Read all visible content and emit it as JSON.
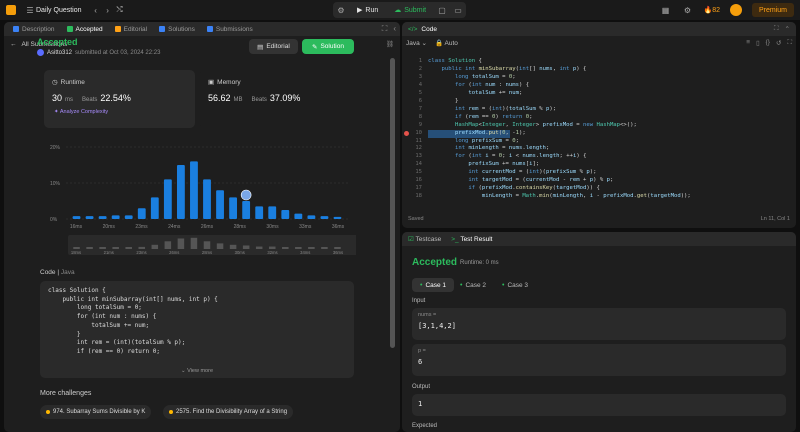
{
  "topbar": {
    "title": "Daily Question",
    "run_label": "Run",
    "submit_label": "Submit",
    "streak": "82",
    "premium_label": "Premium"
  },
  "left": {
    "tabs": [
      {
        "label": "Description",
        "color": "#3b82f6"
      },
      {
        "label": "Accepted",
        "color": "#2cbb5d"
      },
      {
        "label": "Editorial",
        "color": "#ffa116"
      },
      {
        "label": "Solutions",
        "color": "#3b82f6"
      },
      {
        "label": "Submissions",
        "color": "#3b82f6"
      }
    ],
    "all_submissions": "All Submissions",
    "status": "Accepted",
    "author": "Asitto312",
    "submitted_at": "submitted at Oct 03, 2024 22:23",
    "editorial_button": "Editorial",
    "solution_button": "Solution",
    "runtime": {
      "label": "Runtime",
      "value": "30",
      "unit": "ms",
      "beats_label": "Beats",
      "beats": "22.54%",
      "analyze": "Analyze Complexity"
    },
    "memory": {
      "label": "Memory",
      "value": "56.62",
      "unit": "MB",
      "beats_label": "Beats",
      "beats": "37.09%"
    },
    "code_header": "Code",
    "code_lang": "Java",
    "code_snippet": "class Solution {\n    public int minSubarray(int[] nums, int p) {\n        long totalSum = 0;\n        for (int num : nums) {\n            totalSum += num;\n        }\n        int rem = (int)(totalSum % p);\n        if (rem == 0) return 0;",
    "view_more": "View more",
    "more_challenges": "More challenges",
    "challenges": [
      "974. Subarray Sums Divisible by K",
      "2575. Find the Divisibility Array of a String"
    ]
  },
  "chart_data": {
    "type": "bar",
    "yticks": [
      "20%",
      "10%",
      "0%"
    ],
    "ylim": [
      0,
      20
    ],
    "categories": [
      "16ms",
      "",
      "20ms",
      "",
      "23ms",
      "",
      "",
      "24ms",
      "",
      "26ms",
      "",
      "28ms",
      "",
      "30ms",
      "",
      "33ms",
      "",
      "36ms",
      "",
      "",
      ""
    ],
    "values": [
      0.8,
      0.8,
      0.8,
      1,
      1,
      3,
      6,
      11,
      15,
      16,
      11,
      8,
      6,
      5,
      3.5,
      3.5,
      2.5,
      1.5,
      1,
      0.8,
      0.6
    ],
    "highlight_index": 13,
    "bar_color": "#1a7fe0",
    "xlabels": [
      "16ms",
      "20ms",
      "23ms",
      "24ms",
      "26ms",
      "28ms",
      "30ms",
      "33ms",
      "36ms"
    ],
    "mini_labels": [
      "18ms",
      "21ms",
      "23ms",
      "26ms",
      "28ms",
      "30ms",
      "32ms",
      "34ms",
      "36ms"
    ]
  },
  "editor": {
    "title": "Code",
    "language": "Java",
    "mode": "Auto",
    "saved": "Saved",
    "cursor": "Ln 11, Col 1"
  },
  "testresult": {
    "tab_testcase": "Testcase",
    "tab_result": "Test Result",
    "status": "Accepted",
    "runtime": "Runtime: 0 ms",
    "cases": [
      "Case 1",
      "Case 2",
      "Case 3"
    ],
    "input_label": "Input",
    "nums_key": "nums =",
    "nums_val": "[3,1,4,2]",
    "p_key": "p =",
    "p_val": "6",
    "output_label": "Output",
    "output_val": "1",
    "expected_label": "Expected"
  }
}
